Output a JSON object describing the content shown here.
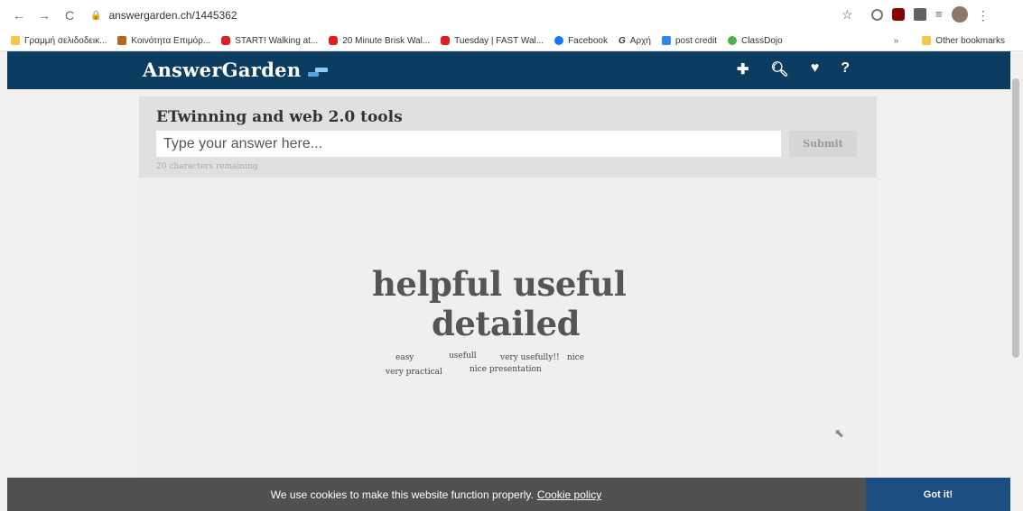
{
  "browser": {
    "url": "answergarden.ch/1445362",
    "bookmarks": [
      {
        "label": "Γραμμή σελιδοδεικ...",
        "icon": "folder-icon"
      },
      {
        "label": "Κοινότητα Επιμόρ...",
        "icon": "tree-icon"
      },
      {
        "label": "START! Walking at...",
        "icon": "youtube-icon"
      },
      {
        "label": "20 Minute Brisk Wal...",
        "icon": "youtube-icon"
      },
      {
        "label": "Tuesday | FAST Wal...",
        "icon": "youtube-icon"
      },
      {
        "label": "Facebook",
        "icon": "facebook-icon"
      },
      {
        "label": "Αρχή",
        "icon": "g-icon"
      },
      {
        "label": "post credit",
        "icon": "postcredit-icon"
      },
      {
        "label": "ClassDojo",
        "icon": "classdojo-icon"
      }
    ],
    "bookmarks_more": "»",
    "other_bookmarks": "Other bookmarks"
  },
  "header": {
    "logo": "AnswerGarden",
    "icons": [
      "plus-icon",
      "search-icon",
      "heart-icon",
      "help-icon"
    ]
  },
  "question": {
    "title": "ETwinning and web 2.0 tools",
    "input_placeholder": "Type your answer here...",
    "submit_label": "Submit",
    "chars_remaining": "20 characters remaining"
  },
  "cloud": {
    "words": [
      {
        "text": "helpful useful",
        "weight": 3
      },
      {
        "text": "detailed",
        "weight": 3
      },
      {
        "text": "easy",
        "weight": 1
      },
      {
        "text": "usefull",
        "weight": 1
      },
      {
        "text": "very usefully!!",
        "weight": 1
      },
      {
        "text": "nice",
        "weight": 1
      },
      {
        "text": "very practical",
        "weight": 1
      },
      {
        "text": "nice presentation",
        "weight": 1
      }
    ]
  },
  "cookie": {
    "text": "We use cookies to make this website function properly.",
    "link": "Cookie policy",
    "button": "Got it!"
  },
  "colors": {
    "header_bg": "#0d3c61",
    "cookie_bg": "#505050",
    "got_it_bg": "#1b4d80"
  }
}
